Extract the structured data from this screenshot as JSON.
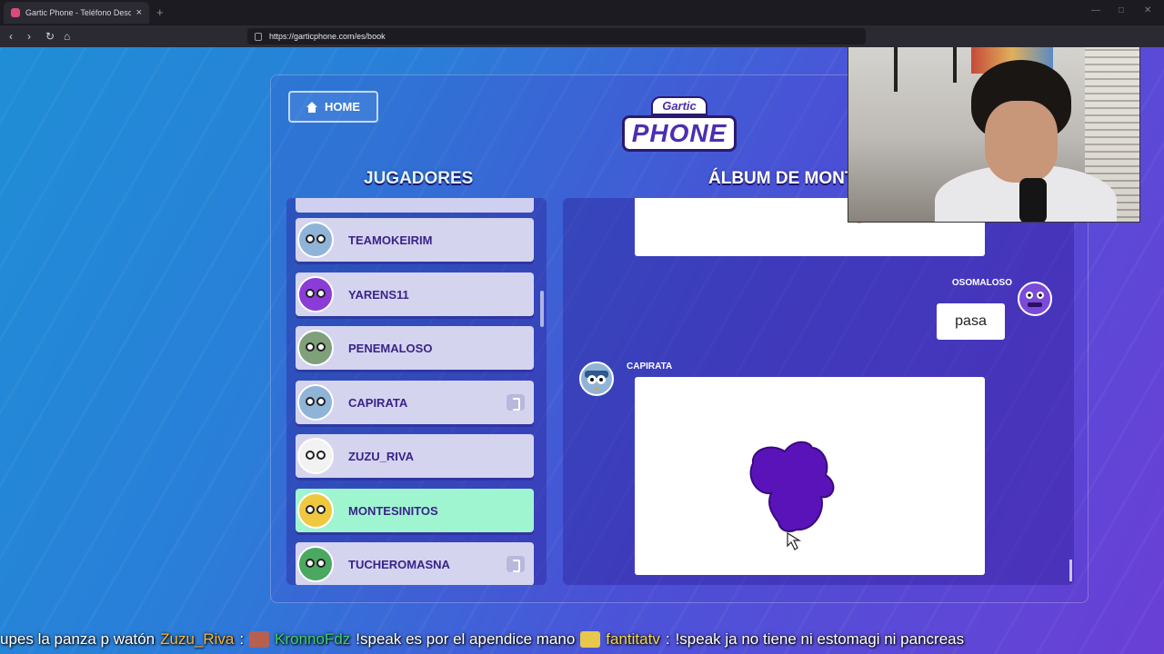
{
  "browser": {
    "tab_title": "Gartic Phone - Teléfono Descon...",
    "tab_close": "×",
    "new_tab": "+",
    "url": "https://garticphone.com/es/book",
    "back": "‹",
    "forward": "›",
    "reload": "↻",
    "home": "⌂"
  },
  "header": {
    "home_label": "HOME",
    "logo_top": "Gartic",
    "logo_main": "PHONE"
  },
  "players": {
    "title": "JUGADORES",
    "items": [
      {
        "name": "TEAMOKEIRIM",
        "avatar_color": "#8fb4d8",
        "highlight": false,
        "kick": false
      },
      {
        "name": "YARENS11",
        "avatar_color": "#8a3bd8",
        "highlight": false,
        "kick": false
      },
      {
        "name": "PENEMALOSO",
        "avatar_color": "#7fa07a",
        "highlight": false,
        "kick": false
      },
      {
        "name": "CAPIRATA",
        "avatar_color": "#8fb4d8",
        "highlight": false,
        "kick": true
      },
      {
        "name": "ZUZU_RIVA",
        "avatar_color": "#f2f2f2",
        "highlight": false,
        "kick": false
      },
      {
        "name": "MONTESINITOS",
        "avatar_color": "#f0c840",
        "highlight": true,
        "kick": false
      },
      {
        "name": "TUCHEROMASNA",
        "avatar_color": "#4aa860",
        "highlight": false,
        "kick": true
      }
    ]
  },
  "album": {
    "title": "ÁLBUM DE MONT",
    "text_entry": {
      "author": "OSOMALOSO",
      "text": "pasa"
    },
    "drawing_entry": {
      "author": "CAPIRATA"
    }
  },
  "chat": {
    "fragment": "upes la panza p watón",
    "messages": [
      {
        "user": "Zuzu_Riva",
        "sep": ":",
        "text": ""
      },
      {
        "user": "KronnoFdz",
        "sep": ":",
        "text": "!speak es por el apendice mano"
      },
      {
        "user": "fantitatv",
        "sep": ":",
        "text": "!speak ja no tiene ni estomagi ni pancreas"
      }
    ]
  },
  "colors": {
    "highlight_row": "#9ff5cf",
    "player_row": "#d4d4ef",
    "drawing_fill": "#5a13b8"
  }
}
